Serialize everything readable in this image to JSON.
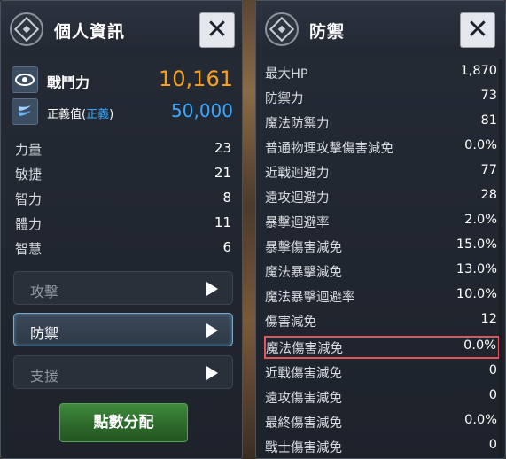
{
  "left_panel": {
    "title": "個人資訊",
    "close_label": "✕",
    "combat_power": {
      "label": "戰鬥力",
      "value": "10,161"
    },
    "justice": {
      "label_prefix": "正義值(",
      "label_tag": "正義",
      "label_suffix": ")",
      "value": "50,000"
    },
    "stats": [
      {
        "label": "力量",
        "value": "23"
      },
      {
        "label": "敏捷",
        "value": "21"
      },
      {
        "label": "智力",
        "value": "8"
      },
      {
        "label": "體力",
        "value": "11"
      },
      {
        "label": "智慧",
        "value": "6"
      }
    ],
    "nav_buttons": [
      {
        "label": "攻擊",
        "active": false
      },
      {
        "label": "防禦",
        "active": true
      },
      {
        "label": "支援",
        "active": false
      }
    ],
    "allocate_label": "點數分配"
  },
  "right_panel": {
    "title": "防禦",
    "close_label": "✕",
    "rows": [
      {
        "label": "最大HP",
        "value": "1,870"
      },
      {
        "label": "防禦力",
        "value": "73"
      },
      {
        "label": "魔法防禦力",
        "value": "81"
      },
      {
        "label": "普通物理攻擊傷害減免",
        "value": "0.0%"
      },
      {
        "label": "近戰迴避力",
        "value": "77"
      },
      {
        "label": "遠攻迴避力",
        "value": "28"
      },
      {
        "label": "暴擊迴避率",
        "value": "2.0%"
      },
      {
        "label": "暴擊傷害減免",
        "value": "15.0%"
      },
      {
        "label": "魔法暴擊減免",
        "value": "13.0%"
      },
      {
        "label": "魔法暴擊迴避率",
        "value": "10.0%"
      },
      {
        "label": "傷害減免",
        "value": "12"
      },
      {
        "label": "魔法傷害減免",
        "value": "0.0%"
      },
      {
        "label": "近戰傷害減免",
        "value": "0"
      },
      {
        "label": "遠攻傷害減免",
        "value": "0"
      },
      {
        "label": "最終傷害減免",
        "value": "0.0%"
      },
      {
        "label": "戰士傷害減免",
        "value": "0"
      }
    ],
    "highlighted_row": "魔法傷害減免"
  }
}
